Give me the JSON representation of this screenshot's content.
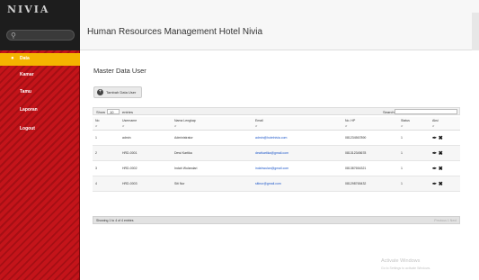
{
  "brand": {
    "logo_text": "NIVIA"
  },
  "sidebar": {
    "search_icon": "search-icon",
    "items": [
      {
        "label": "Data",
        "icon": "home-icon",
        "active": true
      },
      {
        "label": "Kamar",
        "icon": "bed-icon",
        "active": false
      },
      {
        "label": "Tamu",
        "icon": "user-icon",
        "active": false
      },
      {
        "label": "Laporan",
        "icon": "report-icon",
        "active": false
      },
      {
        "label": "Logout",
        "icon": "logout-icon",
        "active": false
      }
    ]
  },
  "header": {
    "title": "Human Resources Management Hotel Nivia"
  },
  "main": {
    "page_title": "Master Data User",
    "add_button_label": "Tambah Data User",
    "toolbar": {
      "show_label": "Show",
      "entries_value": "10",
      "entries_label": "entries",
      "search_label": "Search:"
    },
    "table": {
      "columns": [
        "No",
        "Username",
        "Nama Lengkap",
        "Email",
        "No. HP",
        "Status",
        "Aksi"
      ],
      "rows": [
        {
          "no": "1",
          "username": "admin",
          "nama": "Administrator",
          "email": "admin@hotelnivia.com",
          "hp": "081234567890",
          "status": "1"
        },
        {
          "no": "2",
          "username": "HRD-0001",
          "nama": "Dewi Kartika",
          "email": "dewikartika@gmail.com",
          "hp": "081312345678",
          "status": "1"
        },
        {
          "no": "3",
          "username": "HRD-0002",
          "nama": "Indah Wulandari",
          "email": "indahwulan@gmail.com",
          "hp": "081387654321",
          "status": "1"
        },
        {
          "no": "4",
          "username": "HRD-0003",
          "nama": "Siti Nur",
          "email": "sitinur@gmail.com",
          "hp": "081298765432",
          "status": "1"
        }
      ]
    },
    "footer": {
      "info": "Showing 1 to 4 of 4 entries",
      "pager": "Previous 1 Next"
    }
  },
  "watermark": {
    "line1": "Activate Windows",
    "line2": "Go to Settings to activate Windows."
  }
}
